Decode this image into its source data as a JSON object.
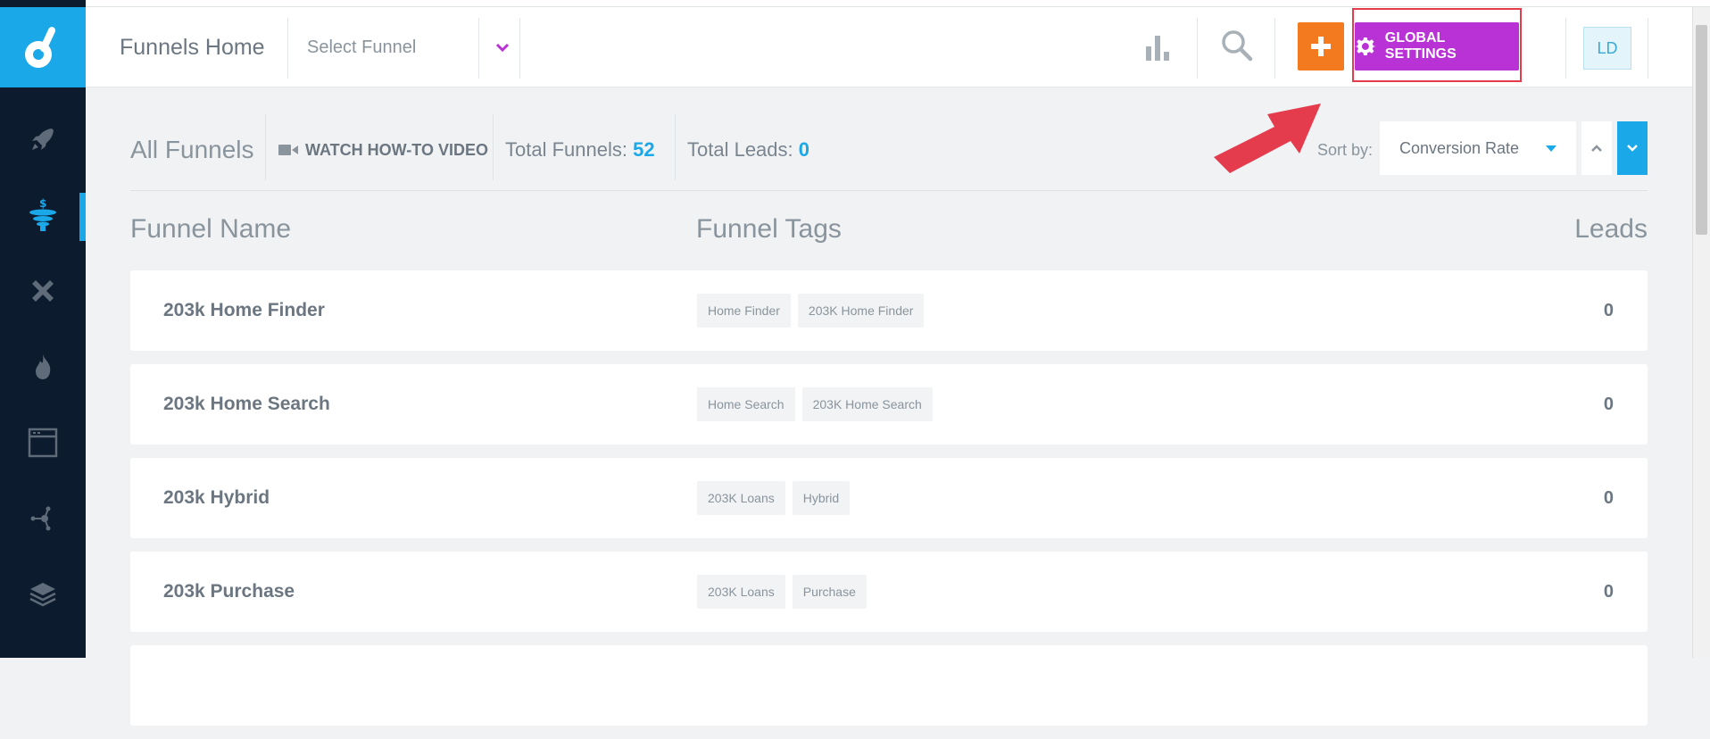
{
  "header": {
    "title": "Funnels Home",
    "select_funnel": "Select Funnel",
    "global_settings": "GLOBAL SETTINGS",
    "avatar_initials": "LD"
  },
  "sidebar": {
    "items": [
      "rocket-icon",
      "funnel-icon",
      "tools-icon",
      "fire-icon",
      "browser-icon",
      "network-icon",
      "layers-icon"
    ]
  },
  "toolbar": {
    "all_funnels": "All Funnels",
    "watch_video": "WATCH HOW-TO VIDEO",
    "total_funnels_label": "Total Funnels:",
    "total_funnels_value": "52",
    "total_leads_label": "Total Leads:",
    "total_leads_value": "0",
    "sort_by": "Sort by:",
    "sort_value": "Conversion Rate"
  },
  "columns": {
    "name": "Funnel Name",
    "tags": "Funnel Tags",
    "leads": "Leads"
  },
  "rows": [
    {
      "name": "203k Home Finder",
      "tags": [
        "Home Finder",
        "203K Home Finder"
      ],
      "leads": "0"
    },
    {
      "name": "203k Home Search",
      "tags": [
        "Home Search",
        "203K Home Search"
      ],
      "leads": "0"
    },
    {
      "name": "203k Hybrid",
      "tags": [
        "203K Loans",
        "Hybrid"
      ],
      "leads": "0"
    },
    {
      "name": "203k Purchase",
      "tags": [
        "203K Loans",
        "Purchase"
      ],
      "leads": "0"
    }
  ],
  "colors": {
    "accent": "#1aa8e8",
    "sidebar": "#0d1b2e",
    "orange": "#f47a1f",
    "purple": "#b832d6",
    "highlight": "#e53c4d"
  }
}
